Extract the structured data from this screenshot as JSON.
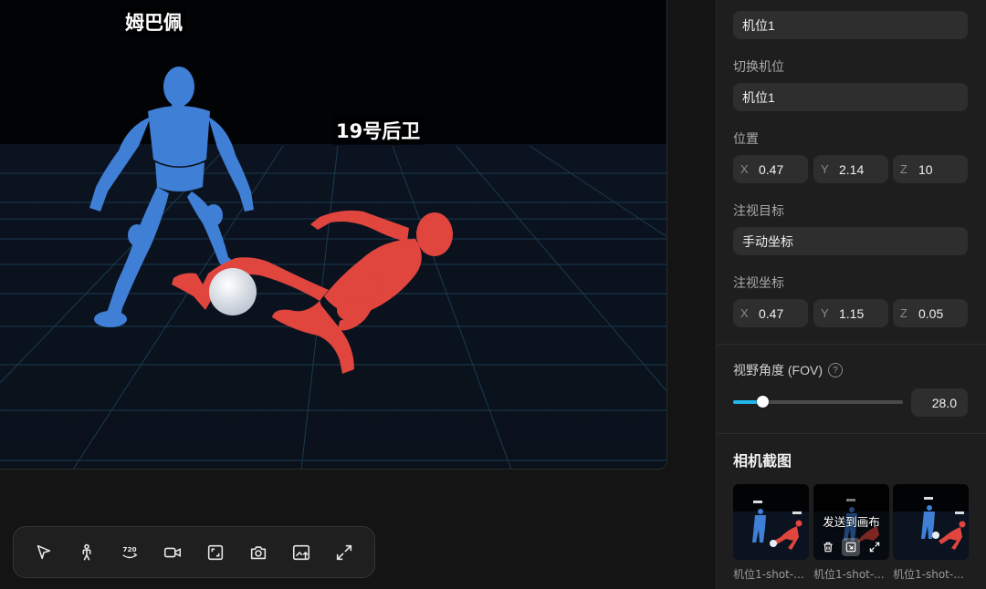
{
  "viewport": {
    "characters": [
      {
        "label": "姆巴佩"
      },
      {
        "label": "19号后卫"
      }
    ],
    "colors": {
      "blue_figure": "#3f7fd6",
      "red_figure": "#e0453e",
      "ball": "#e9edf3",
      "grid": "#1b3a50"
    }
  },
  "toolbar": {
    "tools": [
      {
        "icon": "select-arrow-icon"
      },
      {
        "icon": "person-pose-icon"
      },
      {
        "icon": "rotate-720-icon",
        "text": "720"
      },
      {
        "icon": "video-camera-icon"
      },
      {
        "icon": "frame-crop-icon"
      },
      {
        "icon": "camera-icon"
      },
      {
        "icon": "image-upload-icon"
      },
      {
        "icon": "expand-arrows-icon"
      }
    ]
  },
  "panel": {
    "camera_name": "机位1",
    "switch_camera_label": "切换机位",
    "switch_camera_value": "机位1",
    "position_label": "位置",
    "position": {
      "x_axis": "X",
      "x": "0.47",
      "y_axis": "Y",
      "y": "2.14",
      "z_axis": "Z",
      "z": "10"
    },
    "look_target_label": "注视目标",
    "look_target_value": "手动坐标",
    "look_coords_label": "注视坐标",
    "look_coords": {
      "x_axis": "X",
      "x": "0.47",
      "y_axis": "Y",
      "y": "1.15",
      "z_axis": "Z",
      "z": "0.05"
    },
    "fov_label": "视野角度 (FOV)",
    "fov_help": "?",
    "fov_value": "28.0",
    "fov_fraction": 0.17,
    "accent_color": "#21b7ec",
    "screenshots_title": "相机截图",
    "screenshots": [
      {
        "caption": "机位1-shot-..."
      },
      {
        "caption": "机位1-shot-...",
        "hover_text": "发送到画布"
      },
      {
        "caption": "机位1-shot-..."
      }
    ]
  }
}
